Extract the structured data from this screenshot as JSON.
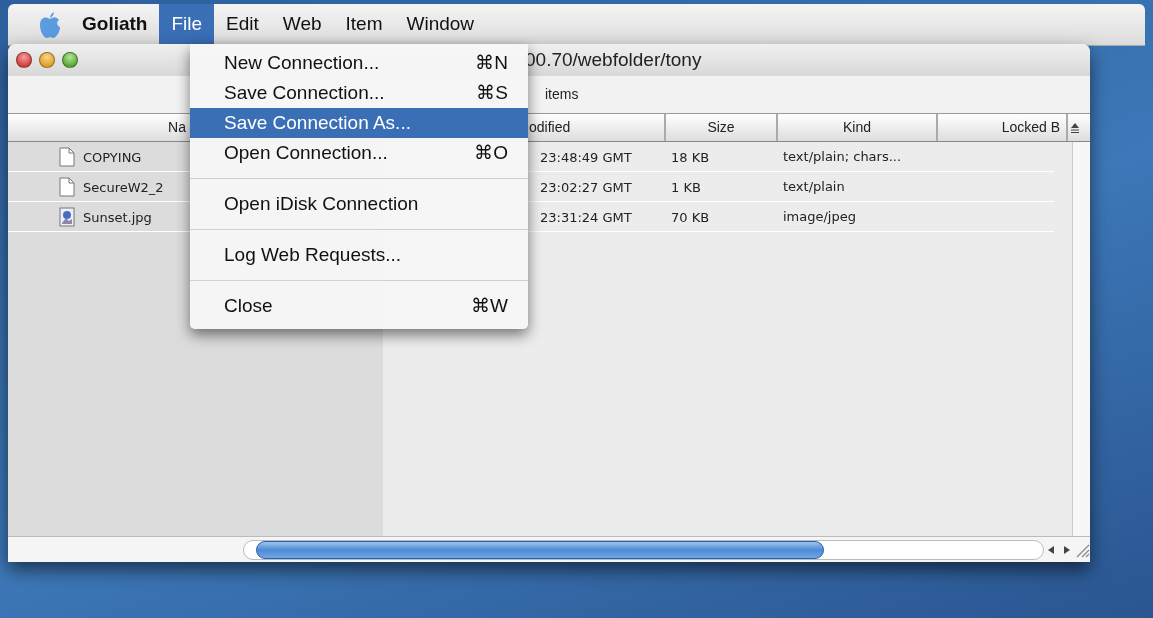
{
  "menubar": {
    "items": [
      {
        "kind": "app",
        "label": "Goliath",
        "selected": false
      },
      {
        "kind": "menu",
        "label": "File",
        "selected": true
      },
      {
        "kind": "menu",
        "label": "Edit",
        "selected": false
      },
      {
        "kind": "menu",
        "label": "Web",
        "selected": false
      },
      {
        "kind": "menu",
        "label": "Item",
        "selected": false
      },
      {
        "kind": "menu",
        "label": "Window",
        "selected": false
      }
    ]
  },
  "window": {
    "title": "00.70/webfolder/tony",
    "status": "items",
    "columns": [
      {
        "label": "Na"
      },
      {
        "label": "odified"
      },
      {
        "label": "Size"
      },
      {
        "label": "Kind"
      },
      {
        "label": "Locked B"
      }
    ],
    "rows": [
      {
        "kind": "document",
        "name": "COPYING",
        "modified": "23:48:49 GMT",
        "size": "18 KB",
        "type": "text/plain; chars..."
      },
      {
        "kind": "document",
        "name": "SecureW2_2",
        "modified": "23:02:27 GMT",
        "size": "1 KB",
        "type": "text/plain"
      },
      {
        "kind": "image",
        "name": "Sunset.jpg",
        "modified": "23:31:24 GMT",
        "size": "70 KB",
        "type": "image/jpeg"
      }
    ]
  },
  "menu": {
    "items": [
      {
        "kind": "item",
        "label": "New Connection...",
        "shortcut": "⌘N",
        "selected": false
      },
      {
        "kind": "item",
        "label": "Save Connection...",
        "shortcut": "⌘S",
        "selected": false
      },
      {
        "kind": "item",
        "label": "Save Connection As...",
        "selected": true
      },
      {
        "kind": "item",
        "label": "Open Connection...",
        "shortcut": "⌘O",
        "selected": false
      },
      {
        "kind": "separator"
      },
      {
        "kind": "item",
        "label": "Open iDisk Connection",
        "selected": false
      },
      {
        "kind": "separator"
      },
      {
        "kind": "item",
        "label": "Log Web Requests...",
        "selected": false
      },
      {
        "kind": "separator"
      },
      {
        "kind": "item",
        "label": "Close",
        "shortcut": "⌘W",
        "selected": false
      }
    ]
  }
}
